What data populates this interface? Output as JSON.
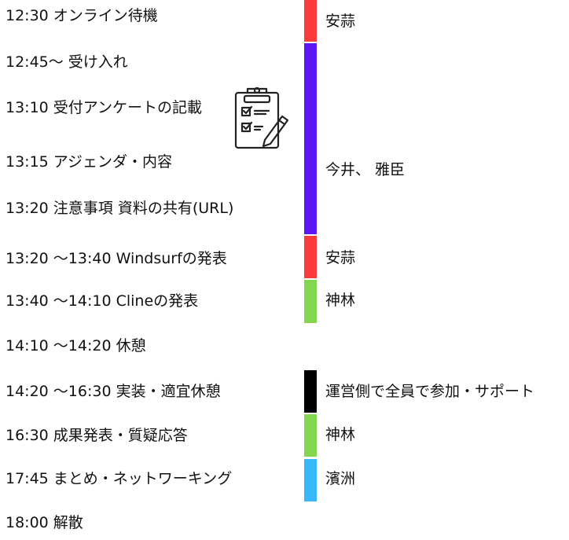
{
  "schedule": [
    "12:30 オンライン待機",
    "12:45〜 受け入れ",
    "13:10 受付アンケートの記載",
    "13:15 アジェンダ・内容",
    "13:20 注意事項 資料の共有(URL)",
    "13:20 〜13:40 Windsurfの発表",
    "13:40 〜14:10 Clineの発表",
    "14:10 〜14:20 休憩",
    "14:20 〜16:30 実装・適宜休憩",
    "16:30 成果発表・質疑応答",
    "17:45 まとめ・ネットワーキング",
    "18:00 解散"
  ],
  "assignees": [
    {
      "name": "安蒜",
      "color": "#fb3a3a"
    },
    {
      "name": "今井、 雅臣",
      "color": "#5d15f5"
    },
    {
      "name": "安蒜",
      "color": "#fb3a3a"
    },
    {
      "name": "神林",
      "color": "#84d64e"
    },
    {
      "name": "運営側で全員で参加・サポート",
      "color": "#000000"
    },
    {
      "name": "神林",
      "color": "#84d64e"
    },
    {
      "name": "濱洲",
      "color": "#38b6fe"
    }
  ],
  "icons": {
    "survey": "clipboard-checklist-pencil-icon"
  }
}
